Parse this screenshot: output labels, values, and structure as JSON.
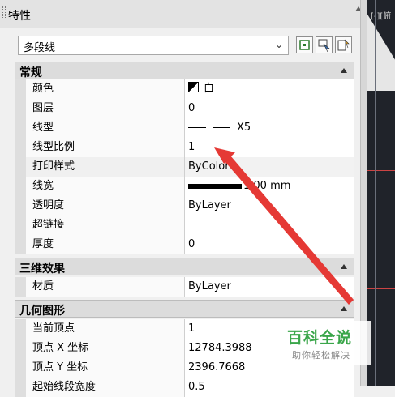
{
  "panel": {
    "title": "特性"
  },
  "selector": {
    "value": "多段线"
  },
  "sections": [
    {
      "label": "常规"
    },
    {
      "label": "三维效果"
    },
    {
      "label": "几何图形"
    }
  ],
  "general": [
    {
      "name": "颜色",
      "value": "白"
    },
    {
      "name": "图层",
      "value": "0"
    },
    {
      "name": "线型",
      "value": "X5"
    },
    {
      "name": "线型比例",
      "value": "1"
    },
    {
      "name": "打印样式",
      "value": "ByColor"
    },
    {
      "name": "线宽",
      "value": "1.00 mm"
    },
    {
      "name": "透明度",
      "value": "ByLayer"
    },
    {
      "name": "超链接",
      "value": ""
    },
    {
      "name": "厚度",
      "value": "0"
    }
  ],
  "three_d": [
    {
      "name": "材质",
      "value": "ByLayer"
    }
  ],
  "geometry": [
    {
      "name": "当前顶点",
      "value": "1"
    },
    {
      "name": "顶点 X 坐标",
      "value": "12784.3988"
    },
    {
      "name": "顶点 Y 坐标",
      "value": "2396.7668"
    },
    {
      "name": "起始线段宽度",
      "value": "0.5"
    }
  ],
  "viewport": {
    "label": "[-][俯"
  },
  "watermark": {
    "main": "百科全说",
    "sub": "助你轻松解决"
  }
}
